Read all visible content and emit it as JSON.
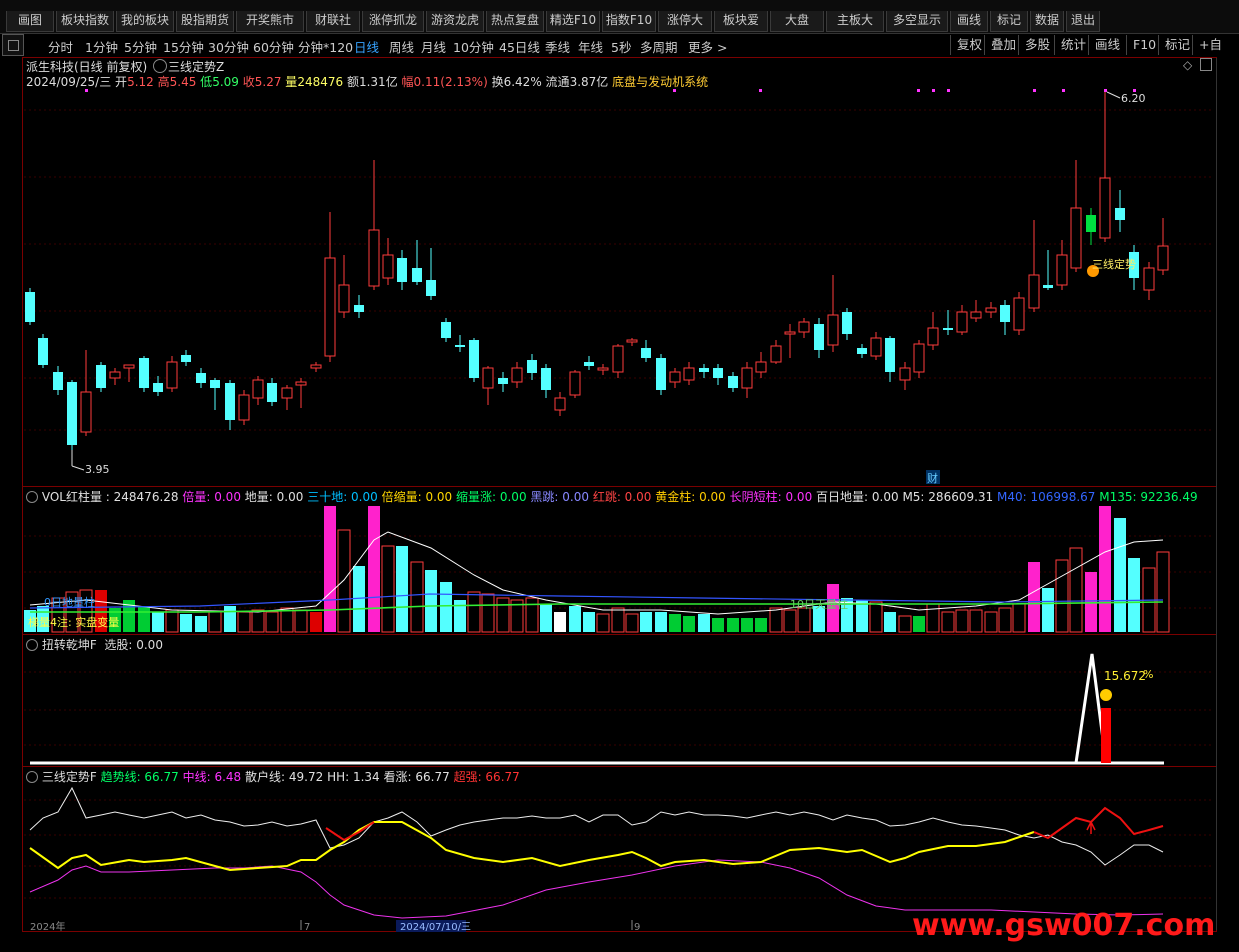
{
  "top_menu": [
    "画图",
    "板块指数",
    "我的板块",
    "股指期货",
    "开奖熊市",
    "财联社",
    "涨停抓龙",
    "游资龙虎",
    "热点复盘",
    "精选F10",
    "指数F10",
    "涨停大",
    "板块爱",
    "大盘",
    "主板大",
    "多空显示",
    "画线",
    "标记",
    "数据",
    "退出"
  ],
  "timeframes": {
    "items": [
      "分时",
      "1分钟",
      "5分钟",
      "15分钟",
      "30分钟",
      "60分钟",
      "分钟*120",
      "日线",
      "周线",
      "月线",
      "10分钟",
      "45日线",
      "季线",
      "年线",
      "5秒",
      "多周期",
      "更多 >"
    ],
    "active": "日线"
  },
  "right_tools": [
    "复权",
    "叠加",
    "多股",
    "统计",
    "画线",
    "F10",
    "标记",
    "+自"
  ],
  "stock": {
    "title": "派生科技(日线 前复权)",
    "indicator": "三线定势Z",
    "date": "2024/09/25/三",
    "open_label": "开",
    "open": "5.12",
    "high_label": "高",
    "high": "5.45",
    "low_label": "低",
    "low": "5.09",
    "close_label": "收",
    "close": "5.27",
    "vol_label": "量",
    "vol": "248476",
    "amt_label": "额",
    "amt": "1.31亿",
    "chg_label": "幅",
    "chg": "0.11(2.13%)",
    "turn_label": "换",
    "turn": "6.42%",
    "float_label": "流通",
    "float": "3.87亿",
    "system": "底盘与发动机系统"
  },
  "main_chart": {
    "high_mark": "6.20",
    "low_mark": "3.95",
    "signal_label": "三线定势",
    "badge": "财"
  },
  "vol_panel": {
    "title": "VOL红柱量",
    "values": [
      {
        "k": "VOL红柱量 : ",
        "v": "248476.28",
        "color": "#e0e0e0"
      },
      {
        "k": "倍量: ",
        "v": "0.00",
        "color": "#ff33ff"
      },
      {
        "k": "地量: ",
        "v": "0.00",
        "color": "#e0e0e0"
      },
      {
        "k": "三十地: ",
        "v": "0.00",
        "color": "#00bfff"
      },
      {
        "k": "倍缩量: ",
        "v": "0.00",
        "color": "#ffd700"
      },
      {
        "k": "缩量涨: ",
        "v": "0.00",
        "color": "#00ff66"
      },
      {
        "k": "黑跳: ",
        "v": "0.00",
        "color": "#8888ff"
      },
      {
        "k": "红跳: ",
        "v": "0.00",
        "color": "#ff4444"
      },
      {
        "k": "黄金柱: ",
        "v": "0.00",
        "color": "#ffcc00"
      },
      {
        "k": "长阴短柱: ",
        "v": "0.00",
        "color": "#ff33ff"
      },
      {
        "k": "百日地量: ",
        "v": "0.00",
        "color": "#e0e0e0"
      },
      {
        "k": "M5: ",
        "v": "286609.31",
        "color": "#e0e0e0"
      },
      {
        "k": "M40: ",
        "v": "106998.67",
        "color": "#3366ff"
      },
      {
        "k": "M135: ",
        "v": "92236.49",
        "color": "#00ff66"
      }
    ],
    "label_a": "0日地量柱",
    "label_b": "梯量4注: 实盘变量",
    "label_c": "10日天量柱"
  },
  "flip_panel": {
    "title": "扭转乾坤F",
    "select_label": "选股: ",
    "select_value": "0.00",
    "pct": "15.672",
    "pct_unit": "%"
  },
  "trend_panel": {
    "title": "三线定势F",
    "values": [
      {
        "k": "趋势线: ",
        "v": "66.77",
        "color": "#00ff66"
      },
      {
        "k": "中线: ",
        "v": "6.48",
        "color": "#ff33ff"
      },
      {
        "k": "散户线: ",
        "v": "49.72",
        "color": "#e0e0e0"
      },
      {
        "k": "HH: ",
        "v": "1.34",
        "color": "#e0e0e0"
      },
      {
        "k": "看涨: ",
        "v": "66.77",
        "color": "#e0e0e0"
      },
      {
        "k": "超强: ",
        "v": "66.77",
        "color": "#ff3333"
      }
    ],
    "date_left": "2024年",
    "date_mid": "2024/07/10/三",
    "tick_7": "7",
    "tick_9": "9"
  },
  "watermark": "www.gsw007.com",
  "colors": {
    "up": "#ff3c3c",
    "down": "#54ffff",
    "bg": "#000000",
    "frame": "#7a0000",
    "magenta": "#ff33cc",
    "yellow": "#ffff00"
  }
}
